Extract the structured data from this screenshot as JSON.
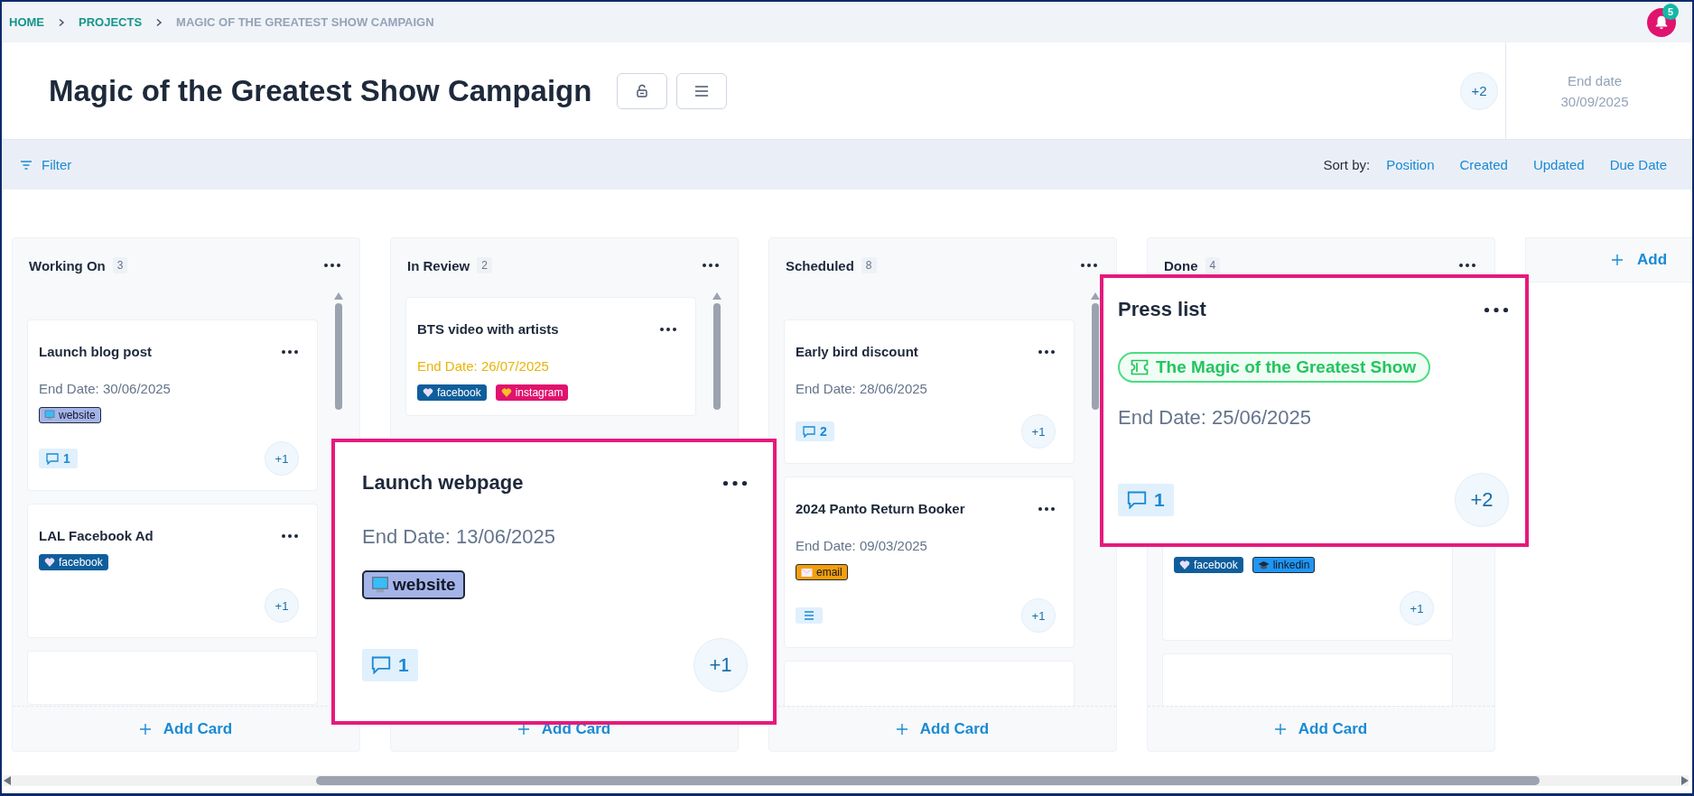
{
  "breadcrumb": [
    {
      "label": "HOME",
      "kind": "link"
    },
    {
      "label": "PROJECTS",
      "kind": "link"
    },
    {
      "label": "MAGIC OF THE GREATEST SHOW CAMPAIGN",
      "kind": "current"
    }
  ],
  "notifications": {
    "count": "5"
  },
  "header": {
    "title": "Magic of the Greatest Show Campaign",
    "members": "+2",
    "end_date": {
      "label": "End date",
      "value": "30/09/2025"
    }
  },
  "toolbar": {
    "filter": "Filter",
    "sort_label": "Sort by:",
    "sort_options": [
      "Position",
      "Created",
      "Updated",
      "Due Date"
    ]
  },
  "columns": [
    {
      "name": "Working On",
      "count": "3",
      "add_label": "Add Card",
      "cards": [
        {
          "kind": "card",
          "title": "Launch blog post",
          "end_date": "End Date: 30/06/2025",
          "due_soon": false,
          "tags": [
            {
              "label": "website",
              "kind": "monitor",
              "color": "#a5b4e8"
            }
          ],
          "badge": {
            "kind": "comments",
            "count": "1"
          },
          "members": "+1"
        },
        {
          "kind": "card",
          "title": "LAL Facebook Ad",
          "tags": [
            {
              "label": "facebook",
              "kind": "heart",
              "color": "#0f5e9c"
            }
          ],
          "members": "+1"
        },
        {
          "kind": "cut"
        }
      ]
    },
    {
      "name": "In Review",
      "count": "2",
      "add_label": "Add Card",
      "cards": [
        {
          "kind": "card",
          "title": "BTS video with artists",
          "end_date": "End Date: 26/07/2025",
          "due_soon": true,
          "tags": [
            {
              "label": "facebook",
              "kind": "heart",
              "color": "#0f5e9c"
            },
            {
              "label": "instagram",
              "kind": "gold-heart",
              "color": "#e0136e"
            }
          ]
        },
        {
          "kind": "covered"
        }
      ]
    },
    {
      "name": "Scheduled",
      "count": "8",
      "add_label": "Add Card",
      "cards": [
        {
          "kind": "card",
          "title": "Early bird discount",
          "end_date": "End Date: 28/06/2025",
          "due_soon": false,
          "badge": {
            "kind": "comments",
            "count": "2"
          },
          "members": "+1"
        },
        {
          "kind": "card",
          "title": "2024 Panto Return Booker",
          "end_date": "End Date: 09/03/2025",
          "due_soon": false,
          "tags": [
            {
              "label": "email",
              "kind": "envelope",
              "color": "#f59e0b"
            }
          ],
          "badge": {
            "kind": "description"
          },
          "members": "+1"
        },
        {
          "kind": "cut"
        }
      ]
    },
    {
      "name": "Done",
      "count": "4",
      "add_label": "Add Card",
      "cards": [
        {
          "kind": "covered"
        },
        {
          "kind": "card",
          "tags": [
            {
              "label": "facebook",
              "kind": "heart",
              "color": "#0f5e9c"
            },
            {
              "label": "linkedin",
              "kind": "cap",
              "color": "#2196f3"
            }
          ],
          "members": "+1"
        },
        {
          "kind": "cut"
        }
      ]
    }
  ],
  "add_list": {
    "label": "Add"
  },
  "callouts": [
    {
      "title": "Launch webpage",
      "end_date": "End Date: 13/06/2025",
      "tags": [
        {
          "label": "website",
          "kind": "monitor",
          "color": "#a5b4e8"
        }
      ],
      "badge": {
        "kind": "comments",
        "count": "1"
      },
      "members": "+1"
    },
    {
      "title": "Press list",
      "campaign": "The Magic of the Greatest Show",
      "end_date": "End Date: 25/06/2025",
      "badge": {
        "kind": "comments",
        "count": "1"
      },
      "members": "+2"
    }
  ]
}
